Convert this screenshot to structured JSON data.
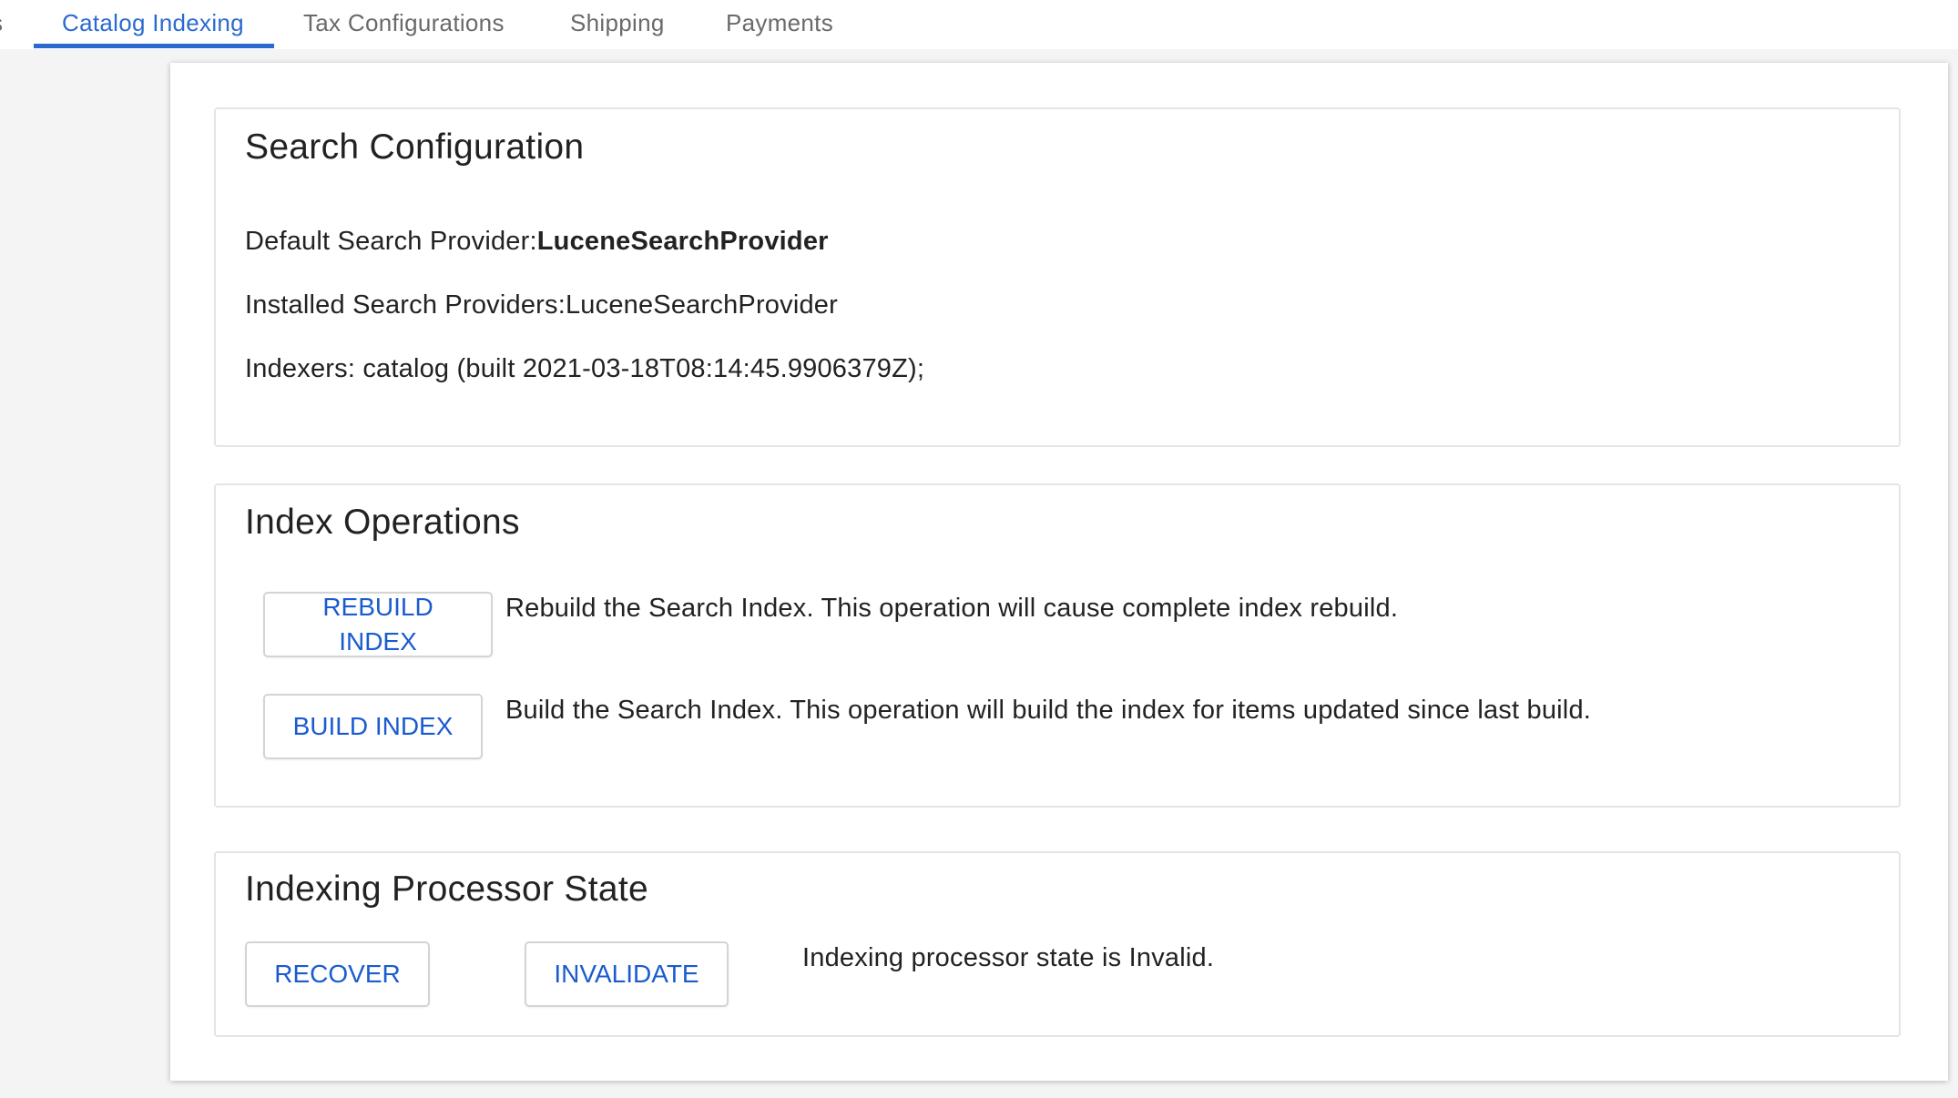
{
  "tabs": [
    {
      "label": "s",
      "active": false
    },
    {
      "label": "Catalog Indexing",
      "active": true
    },
    {
      "label": "Tax Configurations",
      "active": false
    },
    {
      "label": "Shipping",
      "active": false
    },
    {
      "label": "Payments",
      "active": false
    }
  ],
  "search_config": {
    "title": "Search Configuration",
    "default_provider_label": "Default Search Provider:",
    "default_provider_value": "LuceneSearchProvider",
    "installed_providers_label": "Installed Search Providers:",
    "installed_providers_value": "LuceneSearchProvider",
    "indexers_text": "Indexers: catalog (built 2021-03-18T08:14:45.9906379Z);"
  },
  "index_operations": {
    "title": "Index Operations",
    "rebuild_button": "REBUILD INDEX",
    "rebuild_desc": "Rebuild the Search Index. This operation will cause complete index rebuild.",
    "build_button": "BUILD INDEX",
    "build_desc": "Build the Search Index. This operation will build the index for items updated since last build."
  },
  "processor_state": {
    "title": "Indexing Processor State",
    "recover_button": "RECOVER",
    "invalidate_button": "INVALIDATE",
    "status_text": "Indexing processor state is Invalid."
  },
  "colors": {
    "accent": "#2a6ad0",
    "button_text": "#1a5bd0",
    "background": "#f4f4f4"
  }
}
